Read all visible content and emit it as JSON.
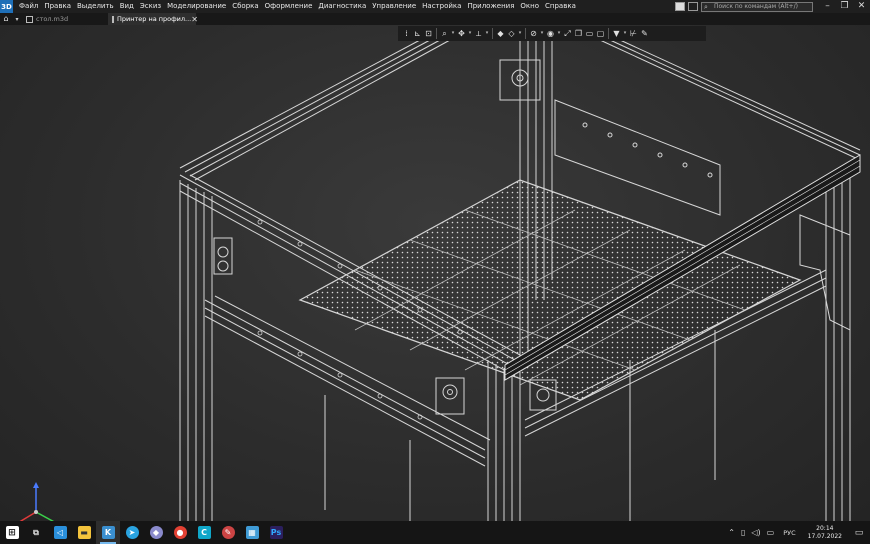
{
  "menubar": {
    "app_logo": "3D",
    "items": [
      "Файл",
      "Правка",
      "Выделить",
      "Вид",
      "Эскиз",
      "Моделирование",
      "Сборка",
      "Оформление",
      "Диагностика",
      "Управление",
      "Настройка",
      "Приложения",
      "Окно",
      "Справка"
    ],
    "search_placeholder": "Поиск по командам (Alt+/)",
    "window_minimize": "–",
    "window_restore": "❐",
    "window_close": "✕"
  },
  "tabs": {
    "home_icon": "home-icon",
    "items": [
      {
        "label": "стол.m3d",
        "active": false
      },
      {
        "label": "Принтер на профил...",
        "active": true
      }
    ],
    "close_label": "✕"
  },
  "view_toolbar": {
    "icons": [
      "view-settings-icon",
      "orientation-icon",
      "fit-icon",
      "zoom-icon",
      "pan-icon",
      "section-icon",
      "display-style-icon",
      "visibility-icon",
      "hide-icon",
      "perspective-icon",
      "filter-icon",
      "measure-icon",
      "pen-icon"
    ]
  },
  "taskbar": {
    "apps": [
      {
        "name": "windows-start-icon",
        "color": "#ffffff"
      },
      {
        "name": "task-view-icon",
        "color": "#dddddd"
      },
      {
        "name": "vscode-icon",
        "color": "#2a8fdb"
      },
      {
        "name": "file-explorer-icon",
        "color": "#f3c33c"
      },
      {
        "name": "kompas3d-icon",
        "color": "#3a8fd0"
      },
      {
        "name": "telegram-icon",
        "color": "#2aa3e0"
      },
      {
        "name": "app-icon",
        "color": "#8a8acc"
      },
      {
        "name": "chrome-icon",
        "color": "#e34133"
      },
      {
        "name": "cura-icon",
        "color": "#10a7c9"
      },
      {
        "name": "paint-icon",
        "color": "#cc4444"
      },
      {
        "name": "calculator-icon",
        "color": "#3f9bd6"
      },
      {
        "name": "photoshop-icon",
        "color": "#2b1f5e"
      }
    ],
    "language": "РУС",
    "time": "20:14",
    "date": "17.07.2022"
  }
}
